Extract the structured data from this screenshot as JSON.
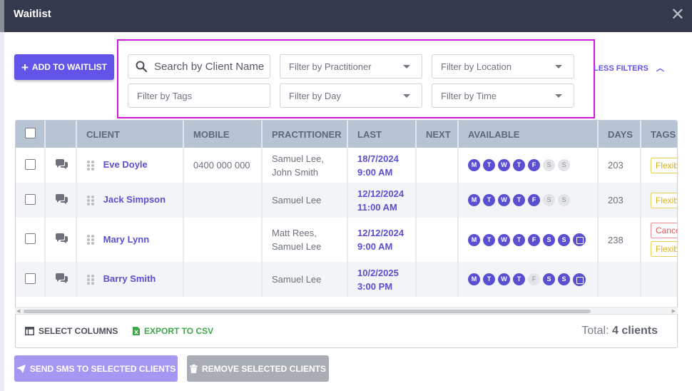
{
  "modal": {
    "title": "Waitlist",
    "close_glyph": "✕"
  },
  "toolbar": {
    "add_label": "ADD TO WAITLIST",
    "less_filters_label": "LESS FILTERS"
  },
  "filters": {
    "search_placeholder": "Search by Client Name",
    "practitioner": "Filter by Practitioner",
    "location": "Filter by Location",
    "tags": "Filter by Tags",
    "day": "Filter by Day",
    "time": "Filter by Time"
  },
  "table": {
    "columns": [
      "",
      "",
      "CLIENT",
      "MOBILE",
      "PRACTITIONER",
      "LAST",
      "NEXT",
      "AVAILABLE",
      "DAYS",
      "TAGS"
    ],
    "rows": [
      {
        "client": "Eve Doyle",
        "mobile": "0400 000 000",
        "pract1": "Samuel Lee,",
        "pract2": "John Smith",
        "last1": "18/7/2024",
        "last2": "9:00 AM",
        "next": "",
        "days": "203",
        "tag1": "Flexible",
        "tag2": ""
      },
      {
        "client": "Jack Simpson",
        "mobile": "",
        "pract1": "Samuel Lee",
        "pract2": "",
        "last1": "12/12/2024",
        "last2": "11:00 AM",
        "next": "",
        "days": "203",
        "tag1": "Flexible",
        "tag2": ""
      },
      {
        "client": "Mary Lynn",
        "mobile": "",
        "pract1": "Matt Rees,",
        "pract2": "Samuel Lee",
        "last1": "12/12/2024",
        "last2": "9:00 AM",
        "next": "",
        "days": "238",
        "tag1": "Cancellation",
        "tag2": "Flexible"
      },
      {
        "client": "Barry Smith",
        "mobile": "",
        "pract1": "Samuel Lee",
        "pract2": "",
        "last1": "10/2/2025",
        "last2": "3:00 PM",
        "next": "",
        "days": "",
        "tag1": "",
        "tag2": ""
      }
    ],
    "day_letters": [
      "M",
      "T",
      "W",
      "T",
      "F",
      "S",
      "S"
    ]
  },
  "footer": {
    "select_columns": "SELECT COLUMNS",
    "export_csv": "EXPORT TO CSV",
    "total_prefix": "Total:",
    "total_value": "4 clients"
  },
  "actions": {
    "send_sms": "SEND SMS TO SELECTED CLIENTS",
    "remove": "REMOVE SELECTED CLIENTS"
  },
  "colors": {
    "accent": "#6254e8",
    "header_bg": "#343a4b",
    "filter_highlight": "#d118d6",
    "export_green": "#3ea84a"
  },
  "icons": [
    "close-icon",
    "plus-icon",
    "search-icon",
    "caret-down-icon",
    "chevron-up-icon",
    "chat-icon",
    "drag-handle-icon",
    "note-icon",
    "columns-icon",
    "csv-file-icon",
    "send-icon",
    "trash-icon"
  ]
}
